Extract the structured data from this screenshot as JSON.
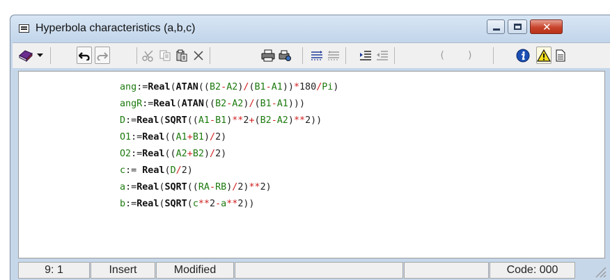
{
  "window": {
    "title": "Hyperbola characteristics (a,b,c)",
    "caption_buttons": {
      "close_glyph": "✕"
    }
  },
  "toolbar": {
    "icons": [
      "book-icon",
      "dropdown-arrow-icon",
      "undo-icon",
      "redo-icon",
      "cut-icon",
      "copy-icon",
      "paste-icon",
      "delete-icon",
      "print-icon",
      "print-settings-icon",
      "indent-lines-icon",
      "outdent-lines-icon",
      "increase-indent-icon",
      "decrease-indent-icon",
      "left-paren-icon",
      "right-paren-icon",
      "info-icon",
      "warning-icon",
      "document-icon"
    ],
    "paren_left": "(",
    "paren_right": ")"
  },
  "editor": {
    "lines": [
      "ang:=Real(ATAN((B2-A2)/(B1-A1))*180/Pi)",
      "angR:=Real(ATAN((B2-A2)/(B1-A1)))",
      "D:=Real(SQRT((A1-B1)**2+(B2-A2)**2))",
      "O1:=Real((A1+B1)/2)",
      "O2:=Real((A2+B2)/2)",
      "c:= Real(D/2)",
      "a:=Real(SQRT((RA-RB)/2)**2)",
      "b:=Real(SQRT(c**2-a**2))"
    ]
  },
  "statusbar": {
    "position": "9: 1",
    "mode": "Insert",
    "state": "Modified",
    "empty1": "",
    "empty2": "",
    "code": "Code: 000"
  },
  "colors": {
    "identifier": "#1d7a0f",
    "operator": "#d02020",
    "keyword": "#111111"
  }
}
